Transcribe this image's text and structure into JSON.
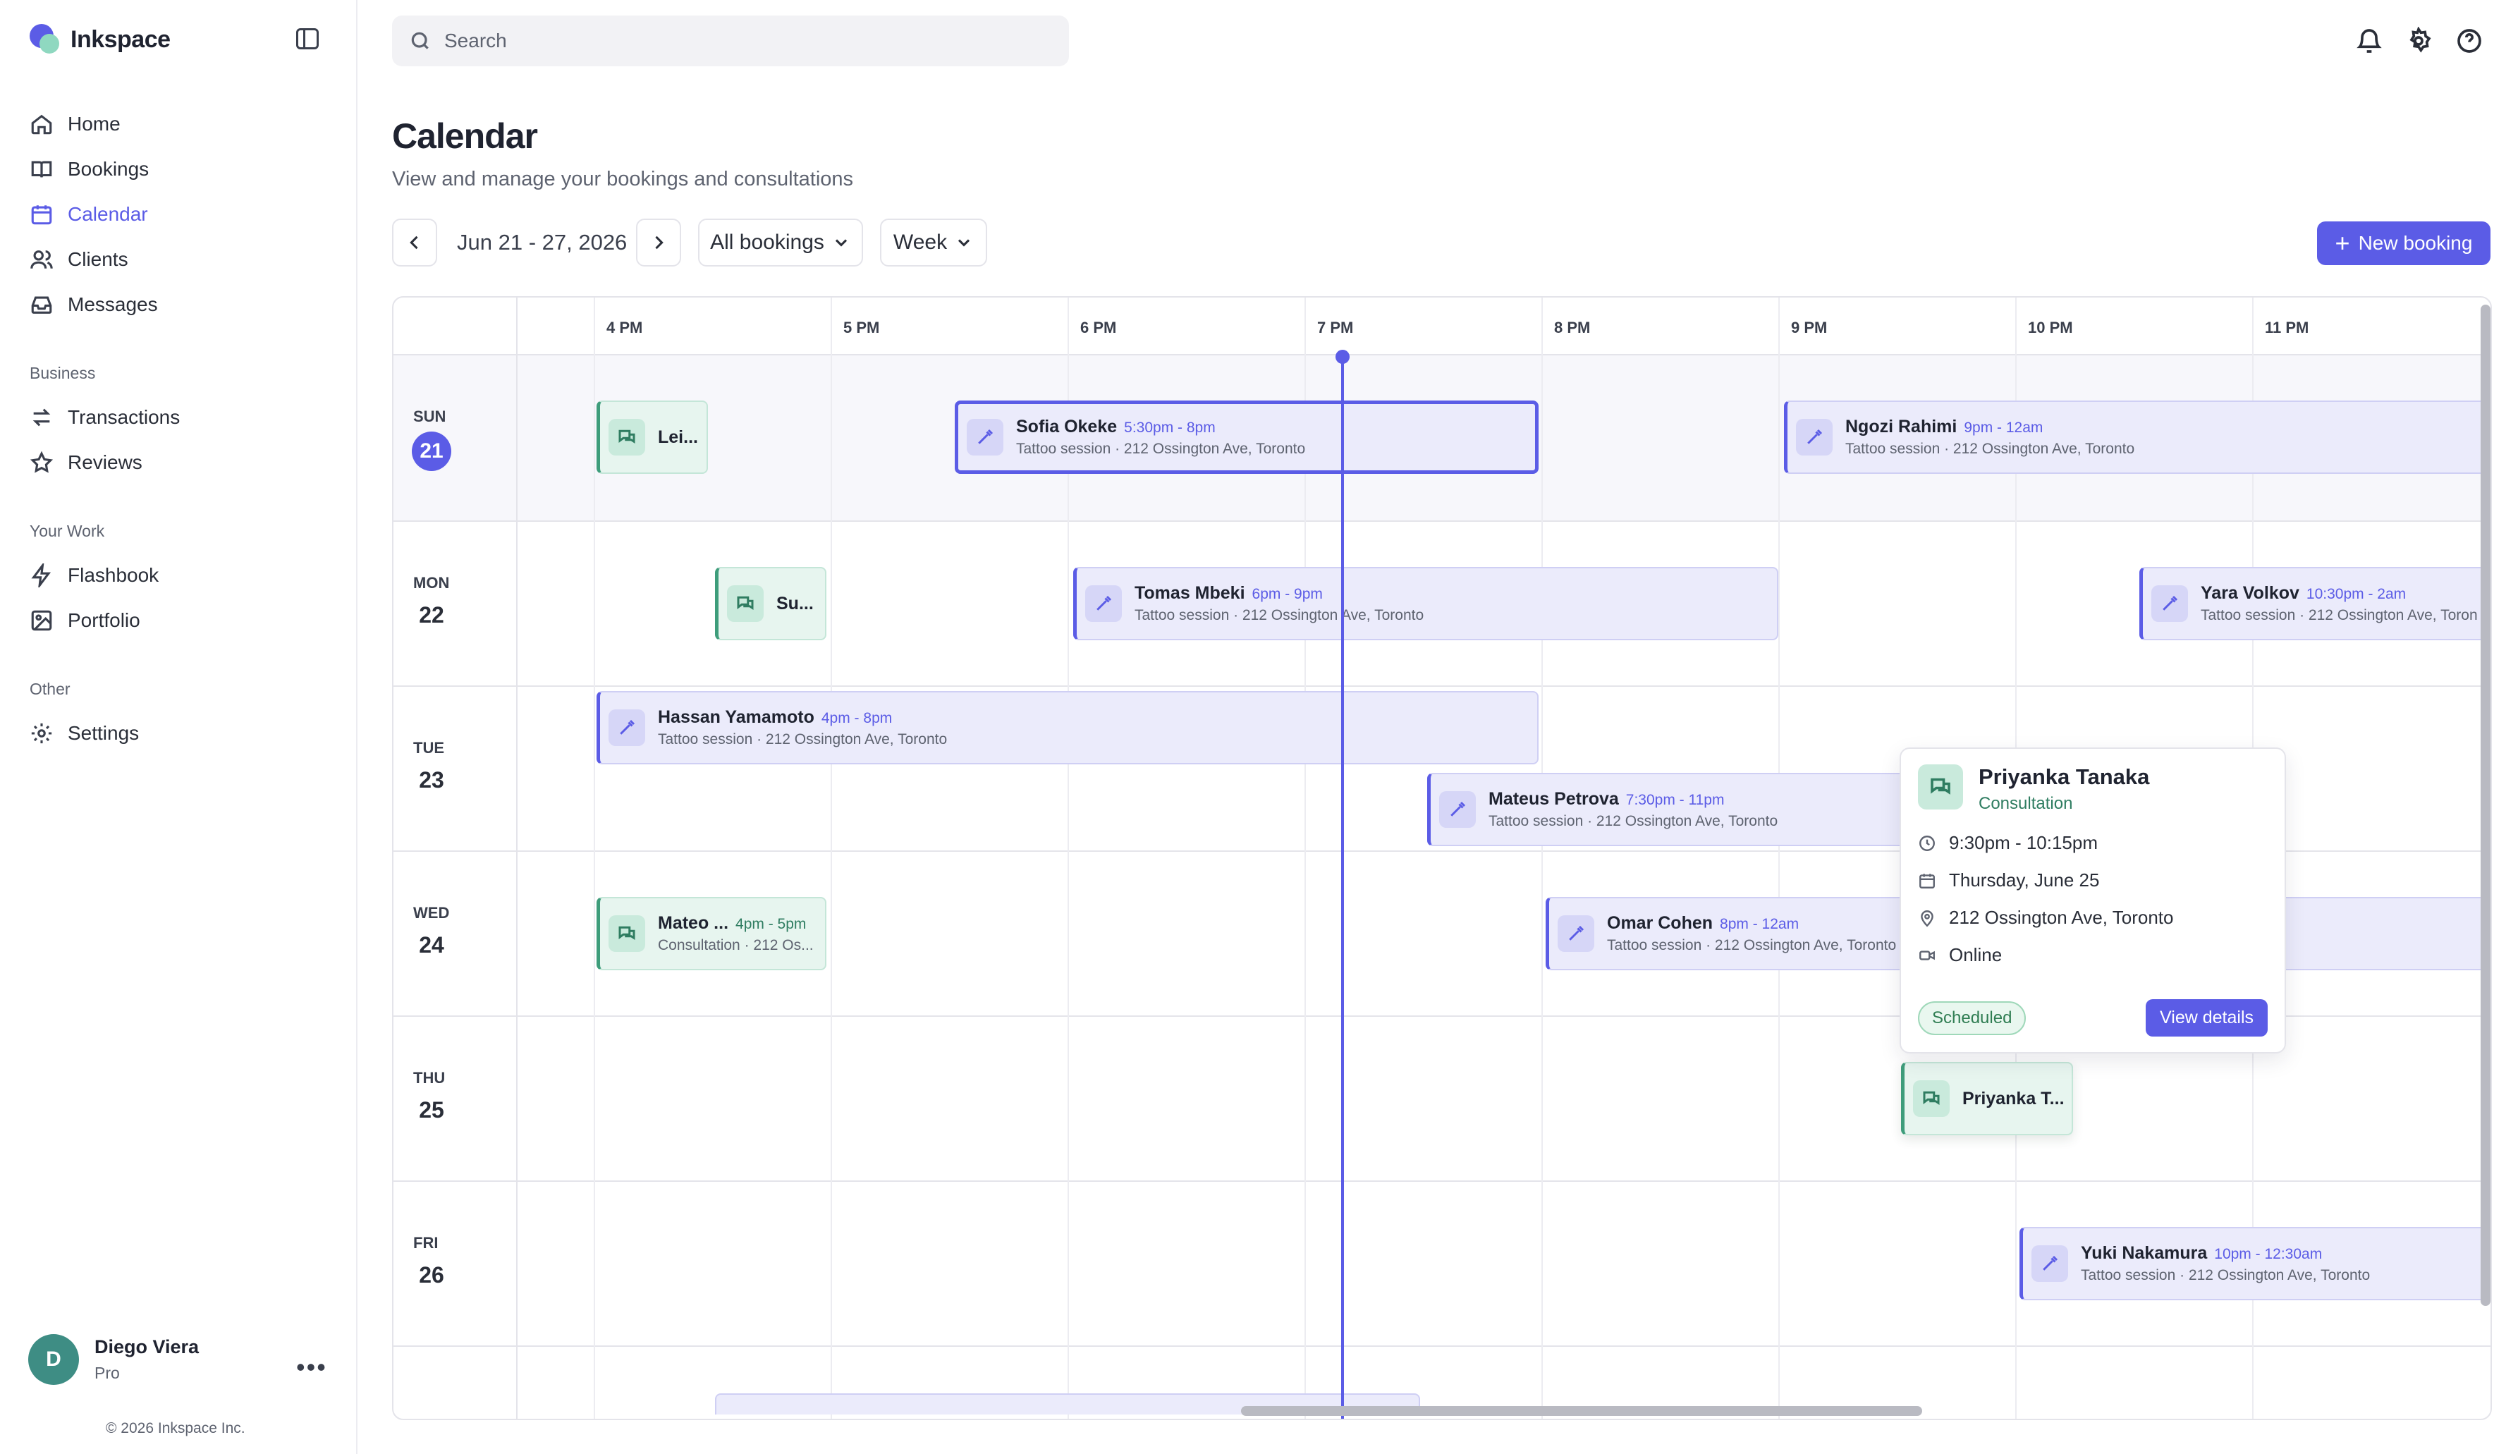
{
  "app": {
    "name": "Inkspace"
  },
  "sidebar": {
    "nav_main": [
      {
        "label": "Home",
        "icon": "home-icon"
      },
      {
        "label": "Bookings",
        "icon": "book-icon"
      },
      {
        "label": "Calendar",
        "icon": "calendar-icon",
        "active": true
      },
      {
        "label": "Clients",
        "icon": "users-icon"
      },
      {
        "label": "Messages",
        "icon": "inbox-icon"
      }
    ],
    "section_business": "Business",
    "nav_business": [
      {
        "label": "Transactions",
        "icon": "arrows-icon"
      },
      {
        "label": "Reviews",
        "icon": "star-icon"
      }
    ],
    "section_work": "Your Work",
    "nav_work": [
      {
        "label": "Flashbook",
        "icon": "bolt-icon"
      },
      {
        "label": "Portfolio",
        "icon": "image-icon"
      }
    ],
    "section_other": "Other",
    "nav_other": [
      {
        "label": "Settings",
        "icon": "gear-icon"
      }
    ],
    "user": {
      "initial": "D",
      "name": "Diego Viera",
      "plan": "Pro"
    },
    "copyright": "© 2026 Inkspace Inc."
  },
  "header": {
    "search_placeholder": "Search"
  },
  "page": {
    "title": "Calendar",
    "subtitle": "View and manage your bookings and consultations"
  },
  "toolbar": {
    "range": "Jun 21 - 27, 2026",
    "filter": "All bookings",
    "view": "Week",
    "new_booking": "New booking"
  },
  "calendar": {
    "hours": [
      "4 PM",
      "5 PM",
      "6 PM",
      "7 PM",
      "8 PM",
      "9 PM",
      "10 PM",
      "11 PM"
    ],
    "days": [
      {
        "dow": "SUN",
        "num": "21",
        "today": true
      },
      {
        "dow": "MON",
        "num": "22"
      },
      {
        "dow": "TUE",
        "num": "23"
      },
      {
        "dow": "WED",
        "num": "24"
      },
      {
        "dow": "THU",
        "num": "25"
      },
      {
        "dow": "FRI",
        "num": "26"
      }
    ],
    "events": {
      "sun_lei": {
        "name": "Lei..."
      },
      "sun_sofia": {
        "name": "Sofia Okeke",
        "time": "5:30pm - 8pm",
        "loc": "Tattoo session · 212 Ossington Ave, Toronto"
      },
      "sun_ngozi": {
        "name": "Ngozi Rahimi",
        "time": "9pm - 12am",
        "loc": "Tattoo session · 212 Ossington Ave, Toronto"
      },
      "mon_su": {
        "name": "Su..."
      },
      "mon_tomas": {
        "name": "Tomas Mbeki",
        "time": "6pm - 9pm",
        "loc": "Tattoo session · 212 Ossington Ave, Toronto"
      },
      "mon_yara": {
        "name": "Yara Volkov",
        "time": "10:30pm - 2am",
        "loc": "Tattoo session · 212 Ossington Ave, Toron"
      },
      "tue_hassan": {
        "name": "Hassan Yamamoto",
        "time": "4pm - 8pm",
        "loc": "Tattoo session · 212 Ossington Ave, Toronto"
      },
      "tue_mateus": {
        "name": "Mateus Petrova",
        "time": "7:30pm - 11pm",
        "loc": "Tattoo session · 212 Ossington Ave, Toronto"
      },
      "wed_mateo": {
        "name": "Mateo ...",
        "time": "4pm - 5pm",
        "loc": "Consultation · 212 Os..."
      },
      "wed_omar": {
        "name": "Omar Cohen",
        "time": "8pm - 12am",
        "loc": "Tattoo session · 212 Ossington Ave, Toronto"
      },
      "thu_priyanka": {
        "name": "Priyanka T..."
      },
      "fri_yuki": {
        "name": "Yuki Nakamura",
        "time": "10pm - 12:30am",
        "loc": "Tattoo session · 212 Ossington Ave, Toronto"
      }
    }
  },
  "popover": {
    "name": "Priyanka Tanaka",
    "type": "Consultation",
    "time": "9:30pm - 10:15pm",
    "date": "Thursday, June 25",
    "location": "212 Ossington Ave, Toronto",
    "mode": "Online",
    "status": "Scheduled",
    "view_details": "View details"
  },
  "colors": {
    "accent": "#5b5ce6",
    "consult": "#3e9d7b"
  }
}
